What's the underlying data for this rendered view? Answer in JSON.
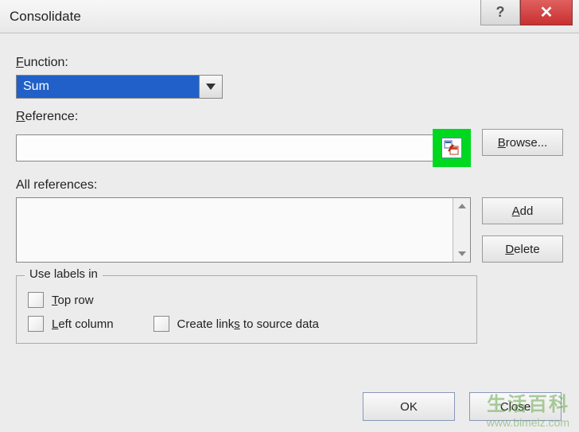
{
  "title": "Consolidate",
  "labels": {
    "function": "Function:",
    "reference": "Reference:",
    "all_references": "All references:",
    "use_labels_in": "Use labels in"
  },
  "function_select": {
    "value": "Sum"
  },
  "reference_input": {
    "value": ""
  },
  "buttons": {
    "browse": "Browse...",
    "add": "Add",
    "delete": "Delete",
    "ok": "OK",
    "close": "Close"
  },
  "checkboxes": {
    "top_row": "Top row",
    "left_column": "Left column",
    "create_links": "Create links to source data"
  },
  "underline": {
    "function": "F",
    "reference": "R",
    "browse": "B",
    "add": "A",
    "delete": "D",
    "top_row": "T",
    "left_column": "L",
    "create_links": "s"
  },
  "watermark": {
    "text": "生活百科",
    "url": "www.bimeiz.com"
  }
}
